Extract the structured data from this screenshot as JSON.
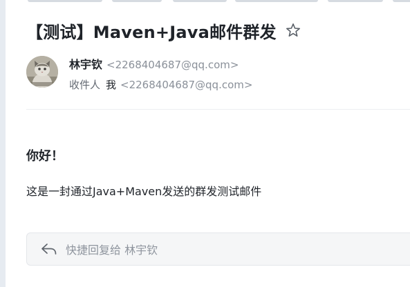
{
  "email": {
    "subject": "【测试】Maven+Java邮件群发",
    "sender": {
      "name": "林宇钦",
      "email": "<2268404687@qq.com>"
    },
    "recipient": {
      "label": "收件人",
      "name": "我",
      "email": "<2268404687@qq.com>"
    },
    "body": {
      "greeting": "你好！",
      "content": "这是一封通过Java+Maven发送的群发测试邮件"
    }
  },
  "reply": {
    "placeholder": "快捷回复给 林宇钦"
  },
  "icons": {
    "star": "star-icon",
    "reply": "reply-arrow-icon",
    "avatar": "cat-avatar"
  },
  "colors": {
    "text": "#1f2329",
    "muted": "#8a9099",
    "reply_bg": "#f5f6f7"
  }
}
